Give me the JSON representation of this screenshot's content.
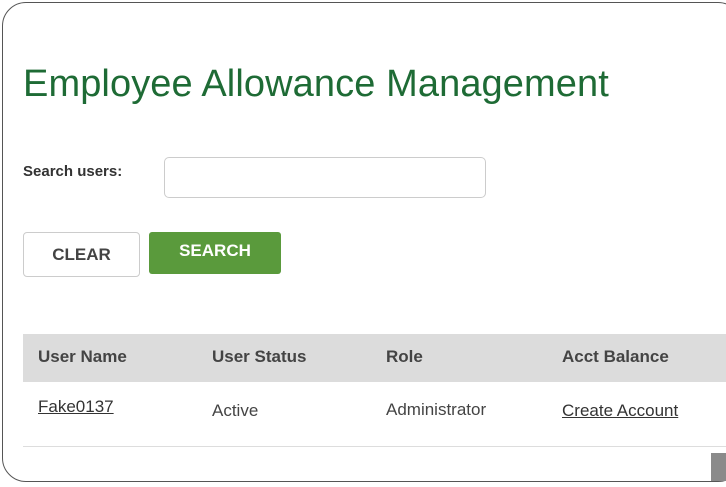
{
  "page": {
    "title": "Employee Allowance Management"
  },
  "search": {
    "label": "Search users:",
    "value": "",
    "placeholder": ""
  },
  "buttons": {
    "clear": "CLEAR",
    "search": "SEARCH"
  },
  "table": {
    "headers": [
      "User Name",
      "User Status",
      "Role",
      "Acct Balance"
    ],
    "rows": [
      {
        "user_name": "Fake0137",
        "user_status": "Active",
        "role": "Administrator",
        "acct_balance": "Create Account"
      }
    ]
  },
  "colors": {
    "title": "#1e6b35",
    "search_button": "#5a9a3c",
    "header_bg": "#dcdcdc"
  }
}
